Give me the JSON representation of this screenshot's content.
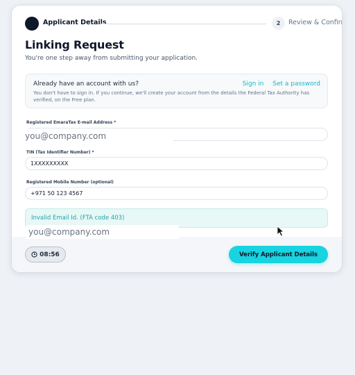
{
  "stepper": {
    "step1_label": "Applicant Details",
    "step2_number": "2",
    "step2_label": "Review & Confirm"
  },
  "page": {
    "title": "Linking Request",
    "subtitle": "You're one step away from submitting your application."
  },
  "info": {
    "question": "Already have an account with us?",
    "sign_in": "Sign in",
    "set_password": "Set a password",
    "text": "You don't have to sign in. If you continue, we'll create your account from the details the Federal Tax Authority has verified, on the Free plan."
  },
  "fields": {
    "email_label": "Registered EmaraTax E-mail Address *",
    "email_placeholder": "you@company.com",
    "email_value": "",
    "tin_label": "TIN (Tax Identifier Number) *",
    "tin_value": "1XXXXXXXXX",
    "mobile_label": "Registered Mobile Number (optional)",
    "mobile_value": "+971 50 123 4567"
  },
  "error": {
    "message": "Invalid Email Id. (FTA code 403)",
    "overlay_placeholder": "you@company.com"
  },
  "footer": {
    "timer": "08:56",
    "verify_label": "Verify Applicant Details"
  },
  "colors": {
    "accent": "#18d3e0",
    "link": "#14b8c4",
    "error_bg": "#e7f8f7",
    "error_text": "#1fa3a8"
  }
}
